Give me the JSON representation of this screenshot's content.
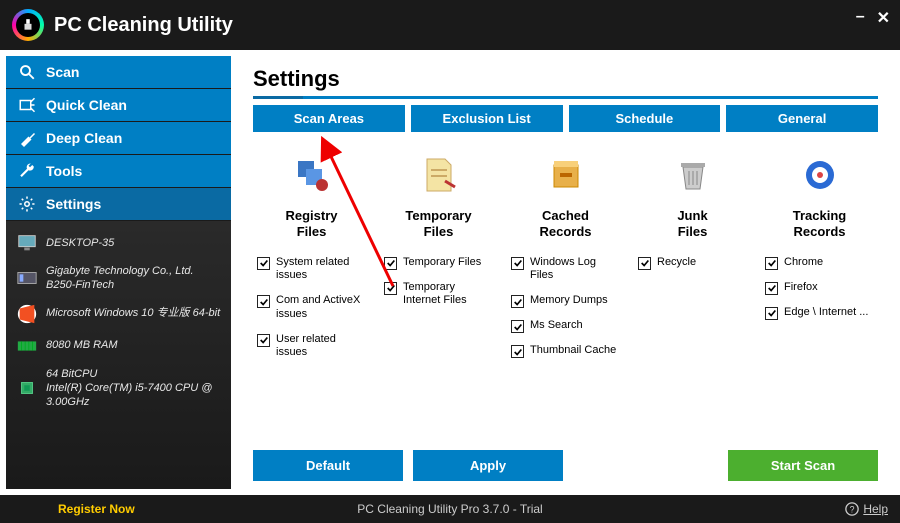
{
  "app": {
    "title": "PC Cleaning Utility"
  },
  "nav": {
    "scan": "Scan",
    "quick_clean": "Quick Clean",
    "deep_clean": "Deep Clean",
    "tools": "Tools",
    "settings": "Settings"
  },
  "system": {
    "host": "DESKTOP-35",
    "mobo": "Gigabyte Technology Co., Ltd. B250-FinTech",
    "os": "Microsoft Windows 10 专业版 64-bit",
    "ram": "8080 MB RAM",
    "cpu": "64 BitCPU\nIntel(R) Core(TM) i5-7400 CPU @ 3.00GHz"
  },
  "page": {
    "title": "Settings"
  },
  "tabs": {
    "scan_areas": "Scan Areas",
    "exclusion": "Exclusion List",
    "schedule": "Schedule",
    "general": "General"
  },
  "columns": {
    "registry": {
      "title": "Registry\nFiles",
      "items": [
        "System related issues",
        "Com and ActiveX issues",
        "User related issues"
      ]
    },
    "temp": {
      "title": "Temporary\nFiles",
      "items": [
        "Temporary Files",
        "Temporary Internet Files"
      ]
    },
    "cached": {
      "title": "Cached\nRecords",
      "items": [
        "Windows Log Files",
        "Memory Dumps",
        "Ms Search",
        "Thumbnail Cache"
      ]
    },
    "junk": {
      "title": "Junk\nFiles",
      "items": [
        "Recycle"
      ]
    },
    "tracking": {
      "title": "Tracking\nRecords",
      "items": [
        "Chrome",
        "Firefox",
        "Edge \\ Internet ..."
      ]
    }
  },
  "buttons": {
    "default": "Default",
    "apply": "Apply",
    "start_scan": "Start Scan"
  },
  "footer": {
    "register": "Register Now",
    "status": "PC Cleaning Utility Pro 3.7.0 - Trial",
    "help": "Help"
  }
}
